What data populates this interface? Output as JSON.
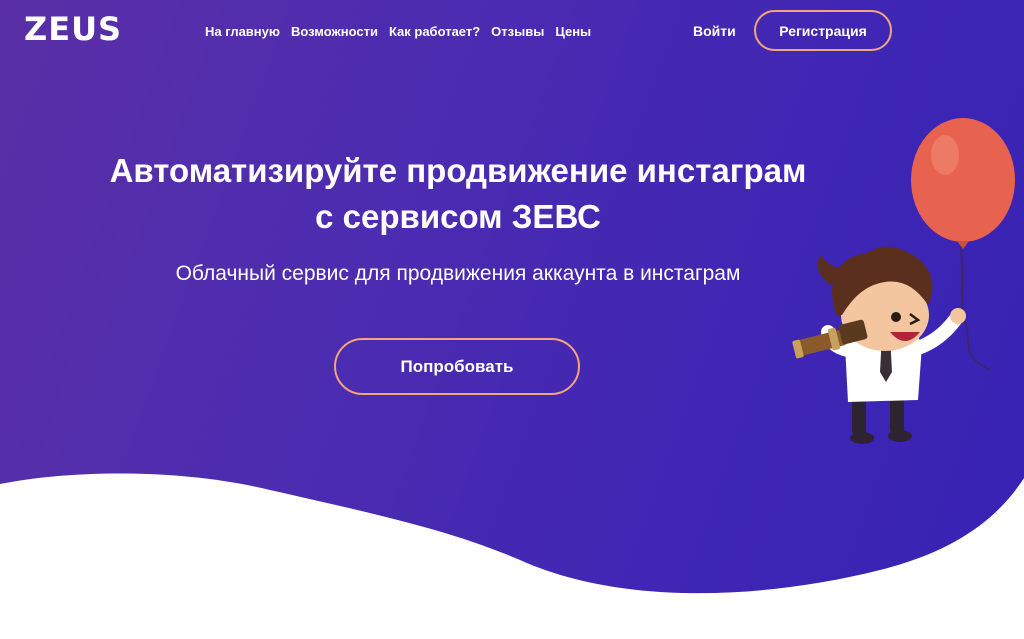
{
  "header": {
    "logo": "ZEUS",
    "nav": [
      "На главную",
      "Возможности",
      "Как работает?",
      "Отзывы",
      "Цены"
    ],
    "login_label": "Войти",
    "register_label": "Регистрация"
  },
  "hero": {
    "title_line1": "Автоматизируйте продвижение инстаграм",
    "title_line2": "с сервисом ЗЕВС",
    "subtitle": "Облачный сервис для продвижения аккаунта в инстаграм",
    "cta_label": "Попробовать"
  },
  "colors": {
    "gradient_start": "#5a2fa6",
    "gradient_end": "#3722b4",
    "accent_border": "#f4a47a",
    "balloon": "#e8634f"
  }
}
